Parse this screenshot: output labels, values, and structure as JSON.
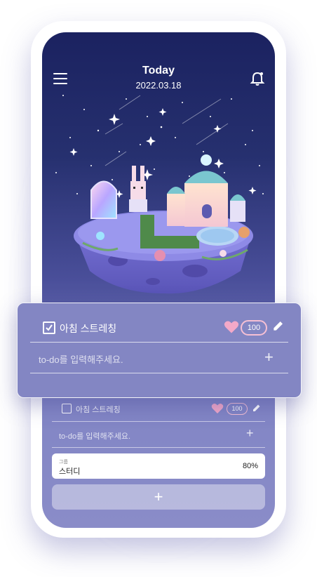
{
  "header": {
    "title": "Today",
    "date": "2022.03.18",
    "menu_icon": "hamburger-menu-icon",
    "bell_icon": "bell-icon"
  },
  "popup": {
    "task_label": "아침 스트레칭",
    "checked": true,
    "like_count": "100",
    "todo_placeholder": "to-do를 입력해주세요.",
    "heart_color": "#f3a9c8"
  },
  "list": {
    "task_label": "아침 스트레칭",
    "like_count": "100",
    "todo_placeholder": "to-do를 입력해주세요."
  },
  "group": {
    "label": "그룹",
    "name": "스터디",
    "percent": "80%"
  },
  "add_button": {
    "label": "+"
  },
  "colors": {
    "sky_top": "#1b2260",
    "card_bg": "#8386c3",
    "accent_pink": "#f3a9c8"
  }
}
